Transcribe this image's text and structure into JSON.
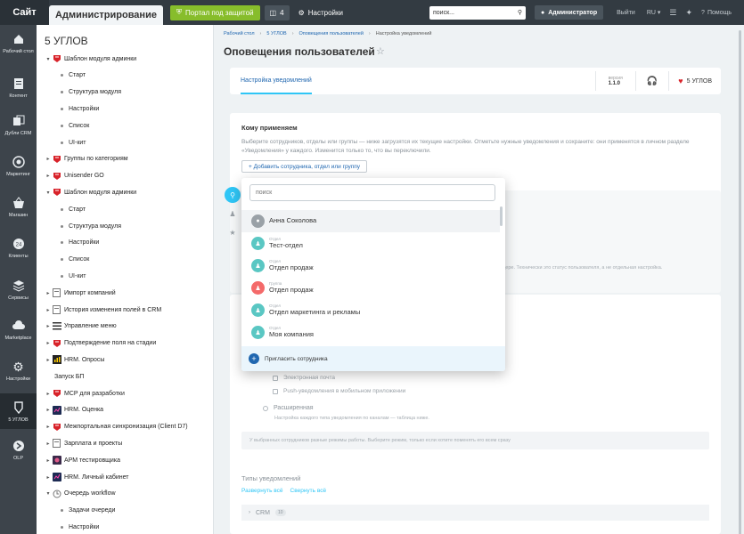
{
  "topbar": {
    "site": "Сайт",
    "admin_tab": "Администрирование",
    "portal_badge": "Портал под защитой",
    "count_badge": "4",
    "settings": "Настройки",
    "search_value": "поиск...",
    "user": "Администратор",
    "logout": "Выйти",
    "lang": "RU",
    "help": "Помощь"
  },
  "leftbar": [
    {
      "label": "Рабочий стол",
      "icon": "home-icon"
    },
    {
      "label": "Контент",
      "icon": "document-icon"
    },
    {
      "label": "Дубли CRM",
      "icon": "duplicates-icon"
    },
    {
      "label": "Маркетинг",
      "icon": "target-icon"
    },
    {
      "label": "Магазин",
      "icon": "basket-icon"
    },
    {
      "label": "Клиенты",
      "icon": "clients-icon"
    },
    {
      "label": "Сервисы",
      "icon": "layers-icon"
    },
    {
      "label": "Marketplace",
      "icon": "cloud-icon"
    },
    {
      "label": "Настройки",
      "icon": "gear-icon"
    },
    {
      "label": "5 УГЛОВ",
      "icon": "module-icon"
    },
    {
      "label": "OLP",
      "icon": "arrow-circle-icon"
    }
  ],
  "tree": {
    "title": "5 УГЛОВ",
    "items": [
      {
        "label": "Шаблон модуля админки",
        "kind": "module"
      },
      {
        "label": "Старт",
        "kind": "sub"
      },
      {
        "label": "Структура модуля",
        "kind": "sub"
      },
      {
        "label": "Настройки",
        "kind": "sub"
      },
      {
        "label": "Список",
        "kind": "sub"
      },
      {
        "label": "UI-кит",
        "kind": "sub"
      },
      {
        "label": "Группы по категориям",
        "kind": "module"
      },
      {
        "label": "Unisender GO",
        "kind": "module"
      },
      {
        "label": "Шаблон модуля админки",
        "kind": "module"
      },
      {
        "label": "Старт",
        "kind": "sub"
      },
      {
        "label": "Структура модуля",
        "kind": "sub"
      },
      {
        "label": "Настройки",
        "kind": "sub"
      },
      {
        "label": "Список",
        "kind": "sub"
      },
      {
        "label": "UI-кит",
        "kind": "sub"
      },
      {
        "label": "Импорт компаний",
        "kind": "page"
      },
      {
        "label": "История изменения полей в CRM",
        "kind": "page"
      },
      {
        "label": "Управление меню",
        "kind": "list"
      },
      {
        "label": "Подтверждение поля на стадии",
        "kind": "module"
      },
      {
        "label": "HRM. Опросы",
        "kind": "chart"
      },
      {
        "label": "Запуск БП",
        "kind": "plain"
      },
      {
        "label": "MCP для разработки",
        "kind": "module"
      },
      {
        "label": "HRM. Оценка",
        "kind": "hrm"
      },
      {
        "label": "Межпортальная синхронизация (Client D7)",
        "kind": "module"
      },
      {
        "label": "Зарплата и проекты",
        "kind": "page"
      },
      {
        "label": "АРМ тестировщика",
        "kind": "arm"
      },
      {
        "label": "HRM. Личный кабинет",
        "kind": "hrm"
      },
      {
        "label": "Очередь workflow",
        "kind": "queue"
      },
      {
        "label": "Задачи очереди",
        "kind": "sub"
      },
      {
        "label": "Настройки",
        "kind": "sub"
      }
    ]
  },
  "breadcrumb": [
    "Рабочий стол",
    "5 УГЛОВ",
    "Оповещения пользователей",
    "Настройка уведомлений"
  ],
  "page_title": "Оповещения пользователей",
  "tabs": {
    "active": "Настройка уведомлений",
    "version_label": "версия",
    "version": "1.1.0",
    "brand": "5 УГЛОВ"
  },
  "apply_card": {
    "title": "Кому применяем",
    "description": "Выберите сотрудников, отделы или группы — ниже загрузятся их текущие настройки. Отметьте нужные уведомления и сохраните: они применятся в личном разделе «Уведомления» у каждого. Изменится только то, что вы переключили.",
    "add_button": "+ Добавить сотрудника, отдел или группу"
  },
  "hidden_hint": "ендере. Технически это статус пользователя, а не отдельная настройка.",
  "channels": {
    "email": "Электронная почта",
    "push": "Push-уведомления в мобильном приложении",
    "extended_title": "Расширенная",
    "extended_sub": "Настройка каждого типа уведомления по каналам — таблица ниже.",
    "note": "У выбранных сотрудников разные режимы работы. Выберите режим, только если хотите поменять его всем сразу"
  },
  "types_card": {
    "title": "Типы уведомлений",
    "expand_all": "Развернуть всё",
    "collapse_all": "Свернуть всё",
    "crm_label": "CRM",
    "crm_count": "10"
  },
  "popup": {
    "search_placeholder": "поиск",
    "items": [
      {
        "type": "",
        "name": "Анна Соколова",
        "kind": "user"
      },
      {
        "type": "Отдел",
        "name": "Тест-отдел",
        "kind": "dept"
      },
      {
        "type": "Отдел",
        "name": "Отдел продаж",
        "kind": "dept"
      },
      {
        "type": "Группа",
        "name": "Отдел продаж",
        "kind": "group"
      },
      {
        "type": "Отдел",
        "name": "Отдел маркетинга и рекламы",
        "kind": "dept"
      },
      {
        "type": "Отдел",
        "name": "Моя компания",
        "kind": "dept"
      }
    ],
    "invite": "Пригласить сотрудника"
  },
  "colors": {
    "accent": "#2fc6f6",
    "link": "#2067b0",
    "portal_green": "#87bd2b",
    "brand_red": "#d8232a"
  }
}
